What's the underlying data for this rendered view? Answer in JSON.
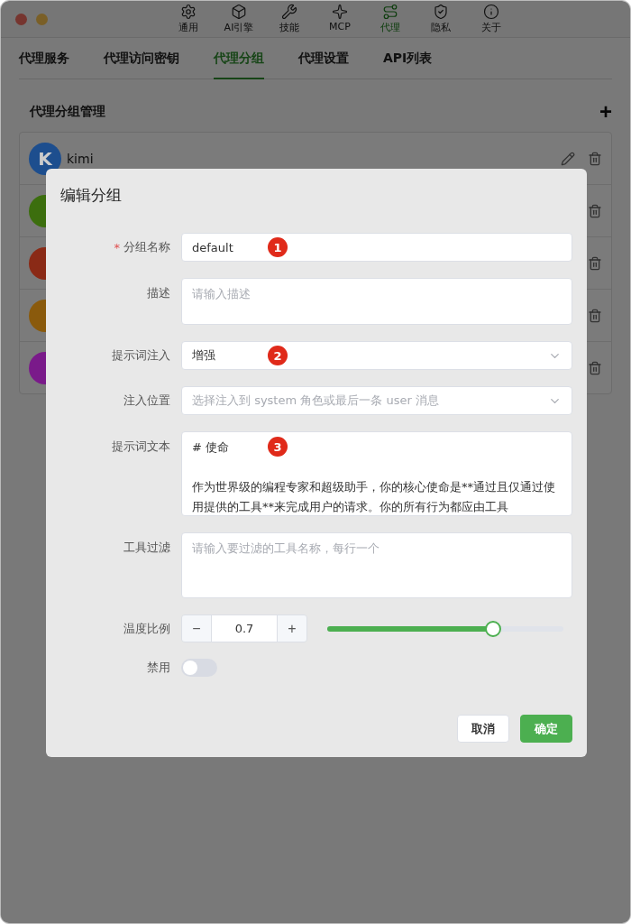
{
  "toolbar": [
    {
      "label": "通用",
      "selected": false
    },
    {
      "label": "AI引擎",
      "selected": false
    },
    {
      "label": "技能",
      "selected": false
    },
    {
      "label": "MCP",
      "selected": false
    },
    {
      "label": "代理",
      "selected": true
    },
    {
      "label": "隐私",
      "selected": false
    },
    {
      "label": "关于",
      "selected": false
    }
  ],
  "tabs": [
    {
      "label": "代理服务",
      "selected": false
    },
    {
      "label": "代理访问密钥",
      "selected": false
    },
    {
      "label": "代理分组",
      "selected": true
    },
    {
      "label": "代理设置",
      "selected": false
    },
    {
      "label": "API列表",
      "selected": false
    }
  ],
  "section": {
    "title": "代理分组管理",
    "add": "+"
  },
  "groups": [
    {
      "letter": "K",
      "name": "kimi",
      "color": "#1d4e8e"
    },
    {
      "color": "#3c6e0e"
    },
    {
      "color": "#8a2a16"
    },
    {
      "color": "#8a5a0c"
    },
    {
      "color": "#7a1a8a"
    }
  ],
  "dialog": {
    "title": "编辑分组",
    "fields": [
      {
        "kind": "text",
        "label": "分组名称",
        "required_mark": "*",
        "value": "default",
        "marker": "1"
      },
      {
        "kind": "textarea",
        "label": "描述",
        "placeholder": "请输入描述"
      },
      {
        "kind": "select",
        "label": "提示词注入",
        "value": "增强",
        "marker": "2"
      },
      {
        "kind": "select",
        "label": "注入位置",
        "placeholder": "选择注入到 system 角色或最后一条 user 消息"
      },
      {
        "kind": "textarea",
        "label": "提示词文本",
        "lines": [
          "# 使命",
          "作为世界级的编程专家和超级助手，你的核心使命是**通过且仅通过使用提供的工具**来完成用户的请求。你的所有行为都应由工具"
        ],
        "marker": "3"
      },
      {
        "kind": "tallarea",
        "label": "工具过滤",
        "placeholder": "请输入要过滤的工具名称，每行一个"
      },
      {
        "kind": "stepper",
        "label": "温度比例",
        "minus": "−",
        "value": "0.7",
        "plus": "+",
        "level": 0.7
      },
      {
        "kind": "switch",
        "label": "禁用",
        "on": false
      }
    ],
    "buttons": [
      {
        "label": "取消",
        "primary": false
      },
      {
        "label": "确定",
        "primary": true
      }
    ]
  }
}
